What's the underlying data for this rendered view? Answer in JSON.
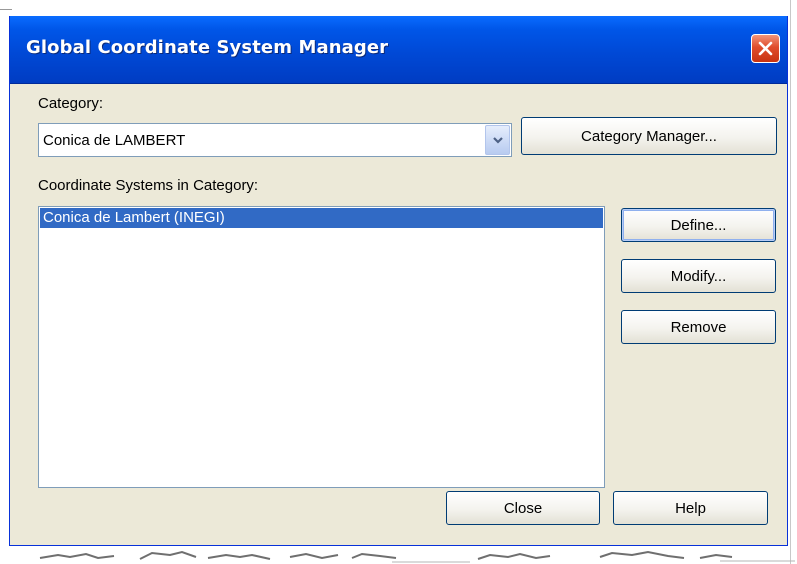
{
  "window": {
    "title": "Global Coordinate System Manager",
    "close_icon": "close-icon",
    "accent_color": "#0054e3",
    "close_color": "#e04d2c"
  },
  "category": {
    "label": "Category:",
    "selected": "Conica de LAMBERT",
    "dropdown_icon": "chevron-down-icon"
  },
  "buttons": {
    "category_manager": "Category Manager...",
    "define": "Define...",
    "modify": "Modify...",
    "remove": "Remove",
    "close": "Close",
    "help": "Help"
  },
  "systems": {
    "label": "Coordinate Systems in Category:",
    "items": [
      {
        "label": "Conica de Lambert (INEGI)",
        "selected": true
      }
    ],
    "selection_color": "#316ac5"
  }
}
